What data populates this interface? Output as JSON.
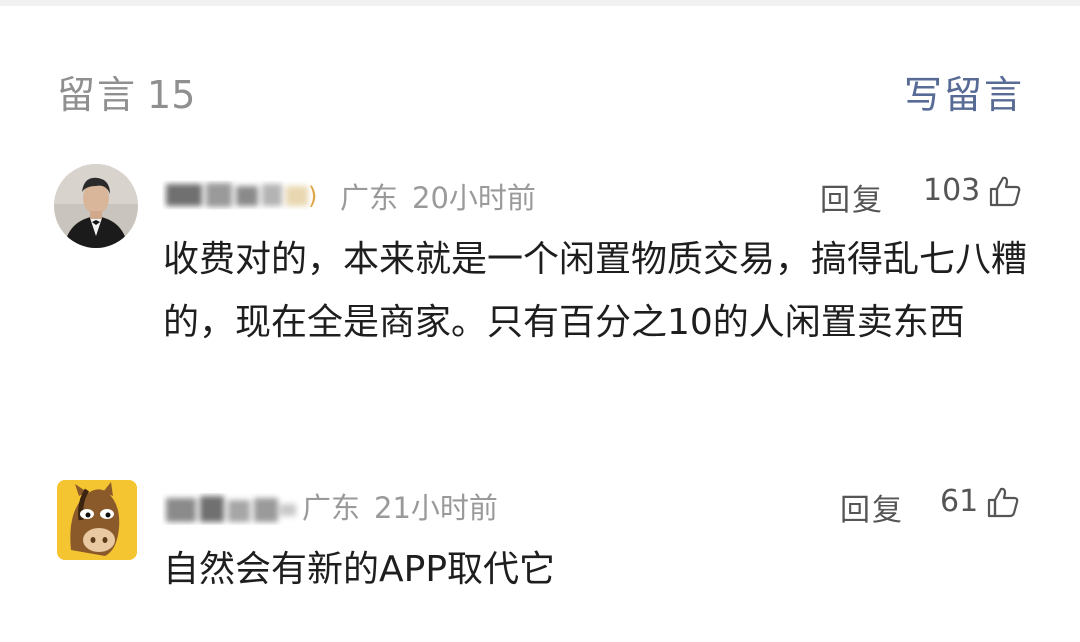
{
  "header": {
    "count_label": "留言",
    "count": "15",
    "write_label": "写留言"
  },
  "comments": [
    {
      "location": "广东",
      "time": "20小时前",
      "reply_label": "回复",
      "likes": "103",
      "text": "收费对的，本来就是一个闲置物质交易，搞得乱七八糟的，现在全是商家。只有百分之10的人闲置卖东西"
    },
    {
      "location": "广东",
      "time": "21小时前",
      "reply_label": "回复",
      "likes": "61",
      "text": "自然会有新的APP取代它"
    }
  ],
  "colors": {
    "link": "#576b95",
    "muted": "#9a9a9a",
    "count": "#8f8f8f",
    "avatar2_bg": "#f4c531"
  }
}
